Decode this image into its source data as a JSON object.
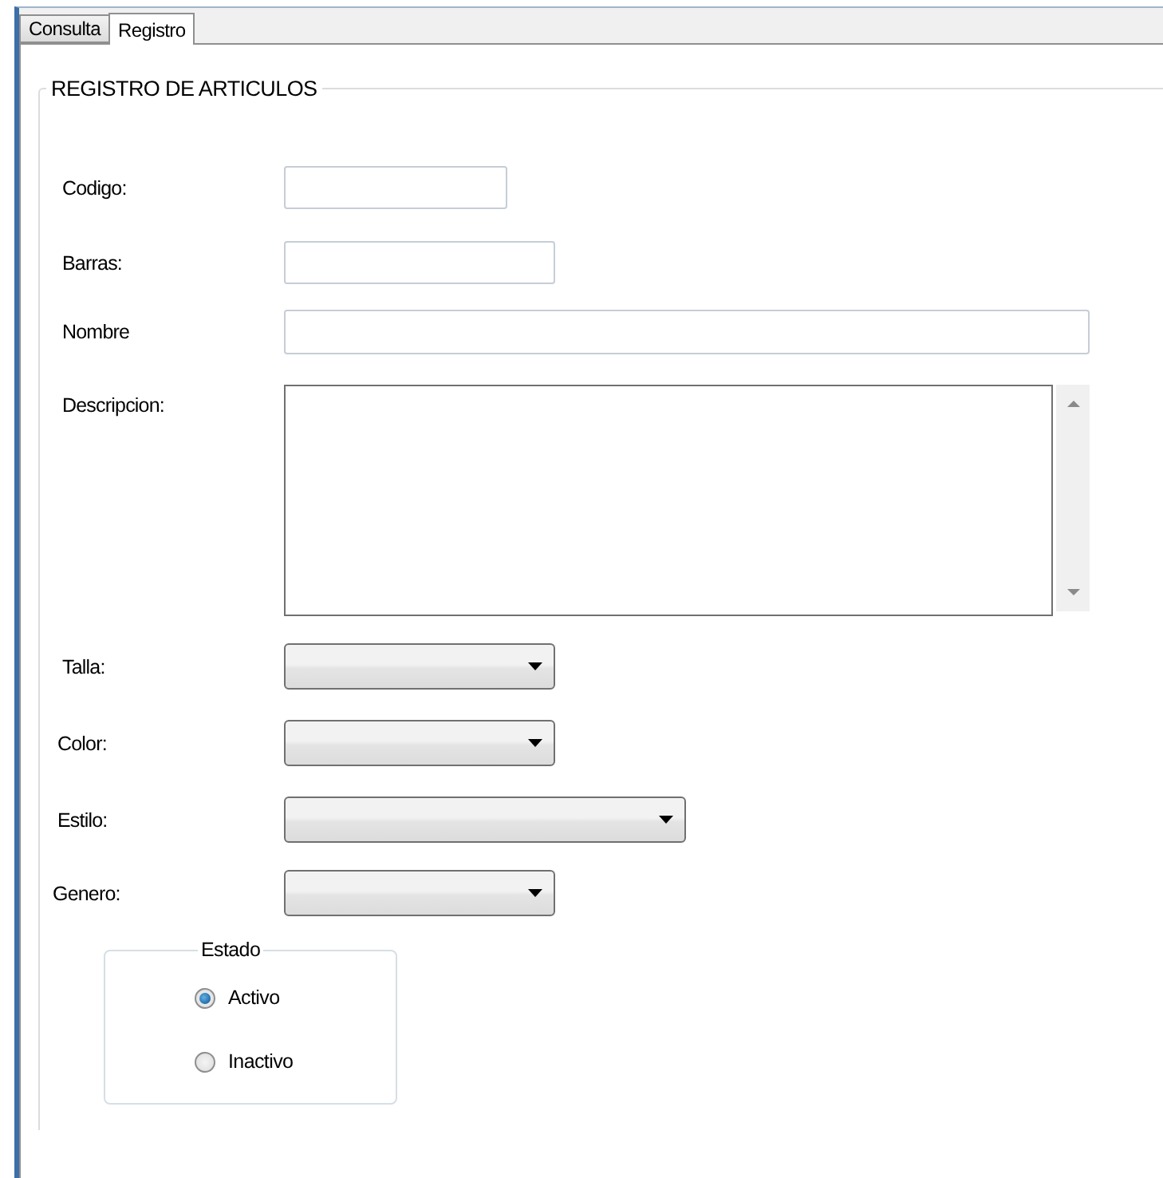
{
  "tabs": [
    {
      "label": "Consulta",
      "selected": false
    },
    {
      "label": "Registro",
      "selected": true
    }
  ],
  "group": {
    "title": "REGISTRO DE ARTICULOS"
  },
  "fields": [
    {
      "label": "Codigo:",
      "kind": "text"
    },
    {
      "label": "Barras:",
      "kind": "text"
    },
    {
      "label": "Nombre",
      "kind": "text"
    },
    {
      "label": "Descripcion:",
      "kind": "memo"
    },
    {
      "label": "Talla:",
      "kind": "combo"
    },
    {
      "label": "Color:",
      "kind": "combo"
    },
    {
      "label": "Estilo:",
      "kind": "combo"
    },
    {
      "label": "Genero:",
      "kind": "combo"
    }
  ],
  "estado": {
    "title": "Estado",
    "options": [
      {
        "label": "Activo",
        "selected": true
      },
      {
        "label": "Inactivo",
        "selected": false
      }
    ]
  }
}
